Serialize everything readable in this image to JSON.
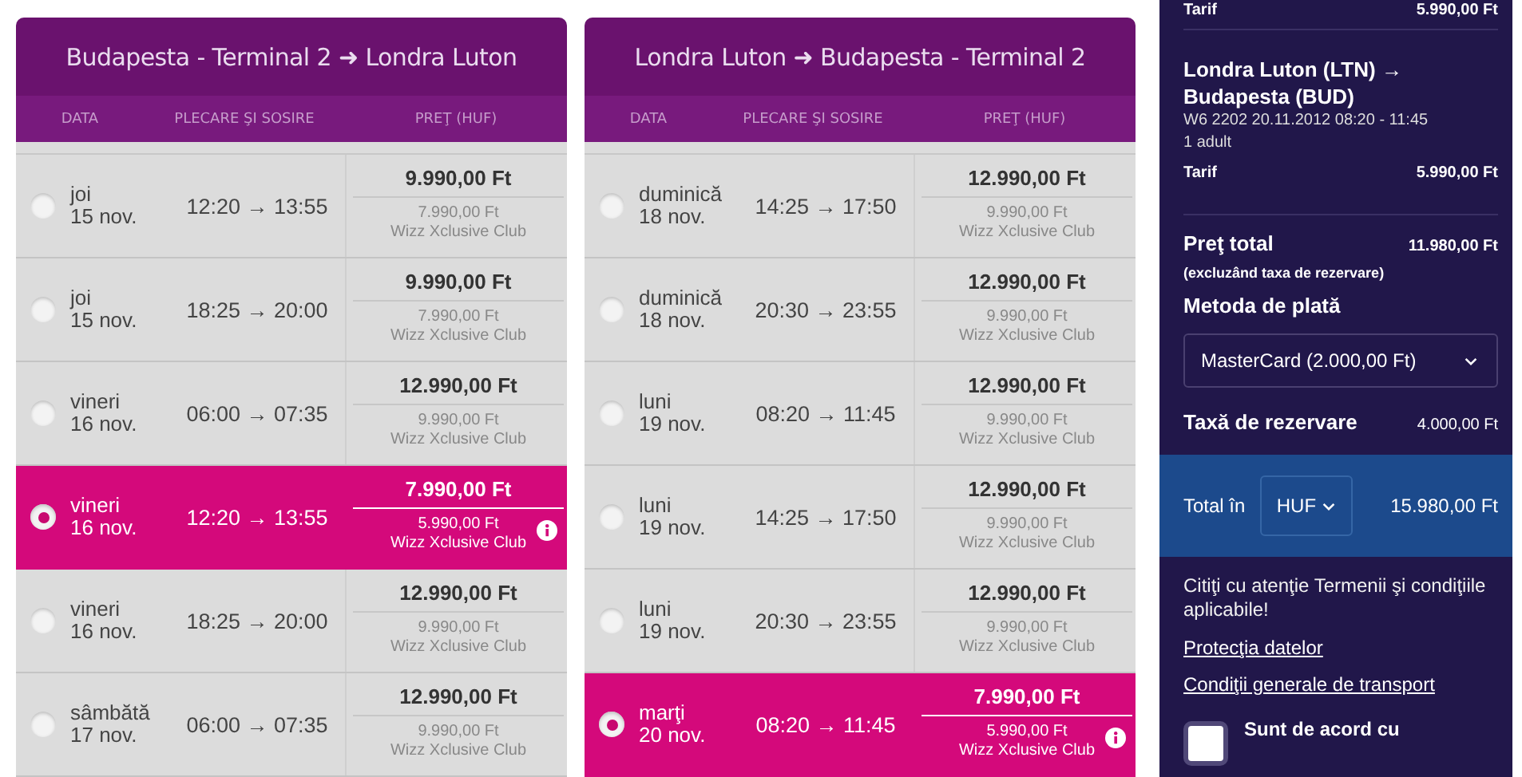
{
  "panels": [
    {
      "title": "Budapesta - Terminal 2 ➜ Londra Luton",
      "columns": [
        "DATA",
        "PLECARE ŞI SOSIRE",
        "PREŢ (HUF)"
      ],
      "rows": [
        {
          "day": "joi",
          "date": "15 nov.",
          "times": "12:20 → 13:55",
          "price": "9.990,00 Ft",
          "club_price": "7.990,00 Ft",
          "club": "Wizz Xclusive Club",
          "selected": false
        },
        {
          "day": "joi",
          "date": "15 nov.",
          "times": "18:25 → 20:00",
          "price": "9.990,00 Ft",
          "club_price": "7.990,00 Ft",
          "club": "Wizz Xclusive Club",
          "selected": false
        },
        {
          "day": "vineri",
          "date": "16 nov.",
          "times": "06:00 → 07:35",
          "price": "12.990,00 Ft",
          "club_price": "9.990,00 Ft",
          "club": "Wizz Xclusive Club",
          "selected": false
        },
        {
          "day": "vineri",
          "date": "16 nov.",
          "times": "12:20 → 13:55",
          "price": "7.990,00 Ft",
          "club_price": "5.990,00 Ft",
          "club": "Wizz Xclusive Club",
          "selected": true
        },
        {
          "day": "vineri",
          "date": "16 nov.",
          "times": "18:25 → 20:00",
          "price": "12.990,00 Ft",
          "club_price": "9.990,00 Ft",
          "club": "Wizz Xclusive Club",
          "selected": false
        },
        {
          "day": "sâmbătă",
          "date": "17 nov.",
          "times": "06:00 → 07:35",
          "price": "12.990,00 Ft",
          "club_price": "9.990,00 Ft",
          "club": "Wizz Xclusive Club",
          "selected": false
        }
      ]
    },
    {
      "title": "Londra Luton ➜ Budapesta - Terminal 2",
      "columns": [
        "DATA",
        "PLECARE ŞI SOSIRE",
        "PREŢ (HUF)"
      ],
      "rows": [
        {
          "day": "duminică",
          "date": "18 nov.",
          "times": "14:25 → 17:50",
          "price": "12.990,00 Ft",
          "club_price": "9.990,00 Ft",
          "club": "Wizz Xclusive Club",
          "selected": false
        },
        {
          "day": "duminică",
          "date": "18 nov.",
          "times": "20:30 → 23:55",
          "price": "12.990,00 Ft",
          "club_price": "9.990,00 Ft",
          "club": "Wizz Xclusive Club",
          "selected": false
        },
        {
          "day": "luni",
          "date": "19 nov.",
          "times": "08:20 → 11:45",
          "price": "12.990,00 Ft",
          "club_price": "9.990,00 Ft",
          "club": "Wizz Xclusive Club",
          "selected": false
        },
        {
          "day": "luni",
          "date": "19 nov.",
          "times": "14:25 → 17:50",
          "price": "12.990,00 Ft",
          "club_price": "9.990,00 Ft",
          "club": "Wizz Xclusive Club",
          "selected": false
        },
        {
          "day": "luni",
          "date": "19 nov.",
          "times": "20:30 → 23:55",
          "price": "12.990,00 Ft",
          "club_price": "9.990,00 Ft",
          "club": "Wizz Xclusive Club",
          "selected": false
        },
        {
          "day": "marţi",
          "date": "20 nov.",
          "times": "08:20 → 11:45",
          "price": "7.990,00 Ft",
          "club_price": "5.990,00 Ft",
          "club": "Wizz Xclusive Club",
          "selected": true
        }
      ]
    }
  ],
  "summary": {
    "top_fare": {
      "label": "Tarif",
      "value": "5.990,00 Ft"
    },
    "flight": {
      "route": "Londra Luton (LTN) → Budapesta (BUD)",
      "details": "W6 2202  20.11.2012 08:20 - 11:45",
      "passengers": "1 adult",
      "fare_label": "Tarif",
      "fare": "5.990,00 Ft"
    },
    "total_label": "Preţ total",
    "total": "11.980,00 Ft",
    "total_note": "(excluzând taxa de rezervare)",
    "payment_label": "Metoda de plată",
    "payment_method": "MasterCard (2.000,00 Ft)",
    "fee_label": "Taxă de rezervare",
    "fee": "4.000,00 Ft",
    "grand_label": "Total în",
    "currency": "HUF",
    "grand_total": "15.980,00 Ft",
    "terms_text": "Citiţi cu atenţie Termenii şi condiţiile aplicabile!",
    "links": [
      "Protecţia datelor",
      "Condiţii generale de transport"
    ],
    "agree": {
      "label": "Sunt de acord cu",
      "checked": false
    }
  }
}
